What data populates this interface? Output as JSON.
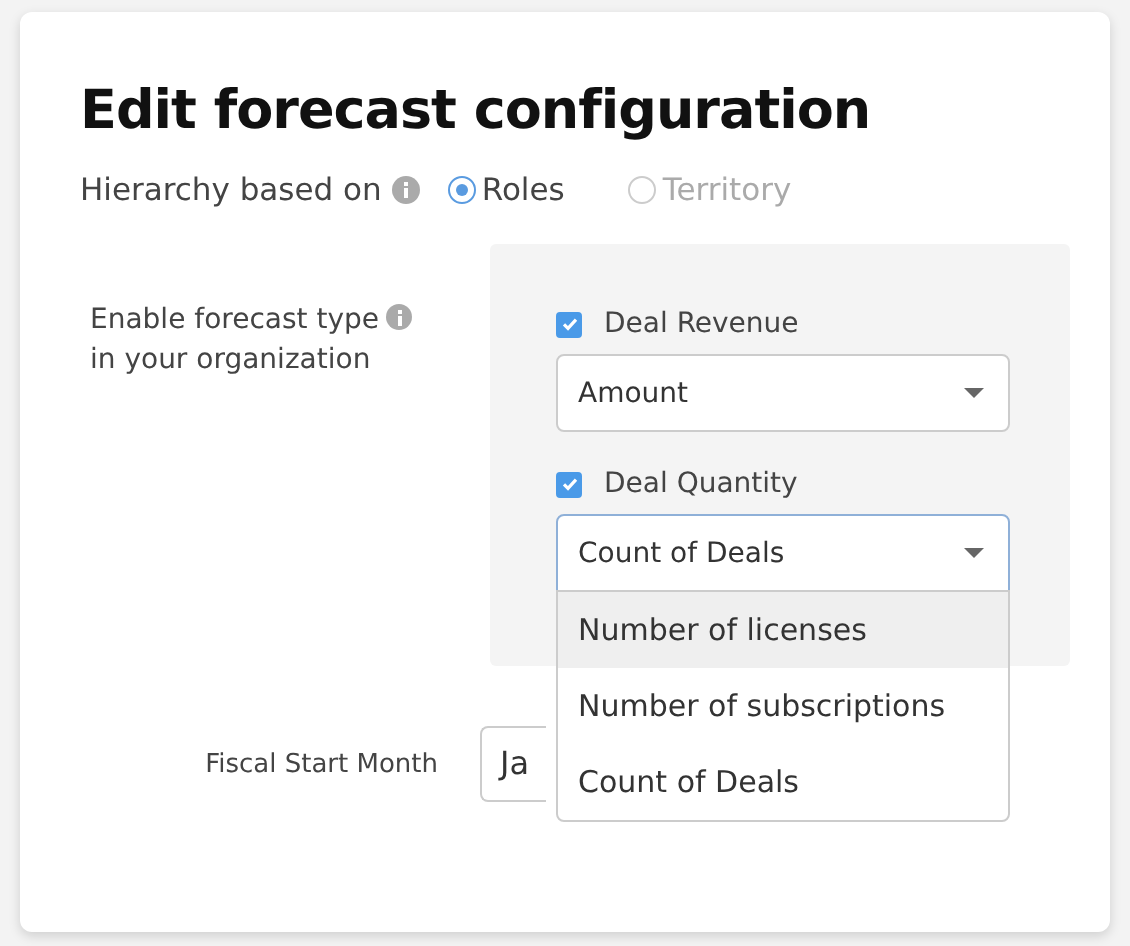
{
  "title": "Edit forecast configuration",
  "hierarchy": {
    "label": "Hierarchy based on",
    "options": [
      {
        "label": "Roles",
        "selected": true
      },
      {
        "label": "Territory",
        "selected": false
      }
    ]
  },
  "forecast_types": {
    "label_lines": [
      "Enable forecast type",
      "in your organization"
    ],
    "items": [
      {
        "label": "Deal Revenue",
        "checked": true,
        "value": "Amount",
        "open": false
      },
      {
        "label": "Deal Quantity",
        "checked": true,
        "value": "Count of Deals",
        "open": true
      }
    ]
  },
  "dropdown_options": [
    {
      "label": "Number of licenses",
      "selected": true
    },
    {
      "label": "Number of subscriptions",
      "selected": false
    },
    {
      "label": "Count of Deals",
      "selected": false
    }
  ],
  "fiscal": {
    "label": "Fiscal Start Month",
    "value": "Ja"
  }
}
